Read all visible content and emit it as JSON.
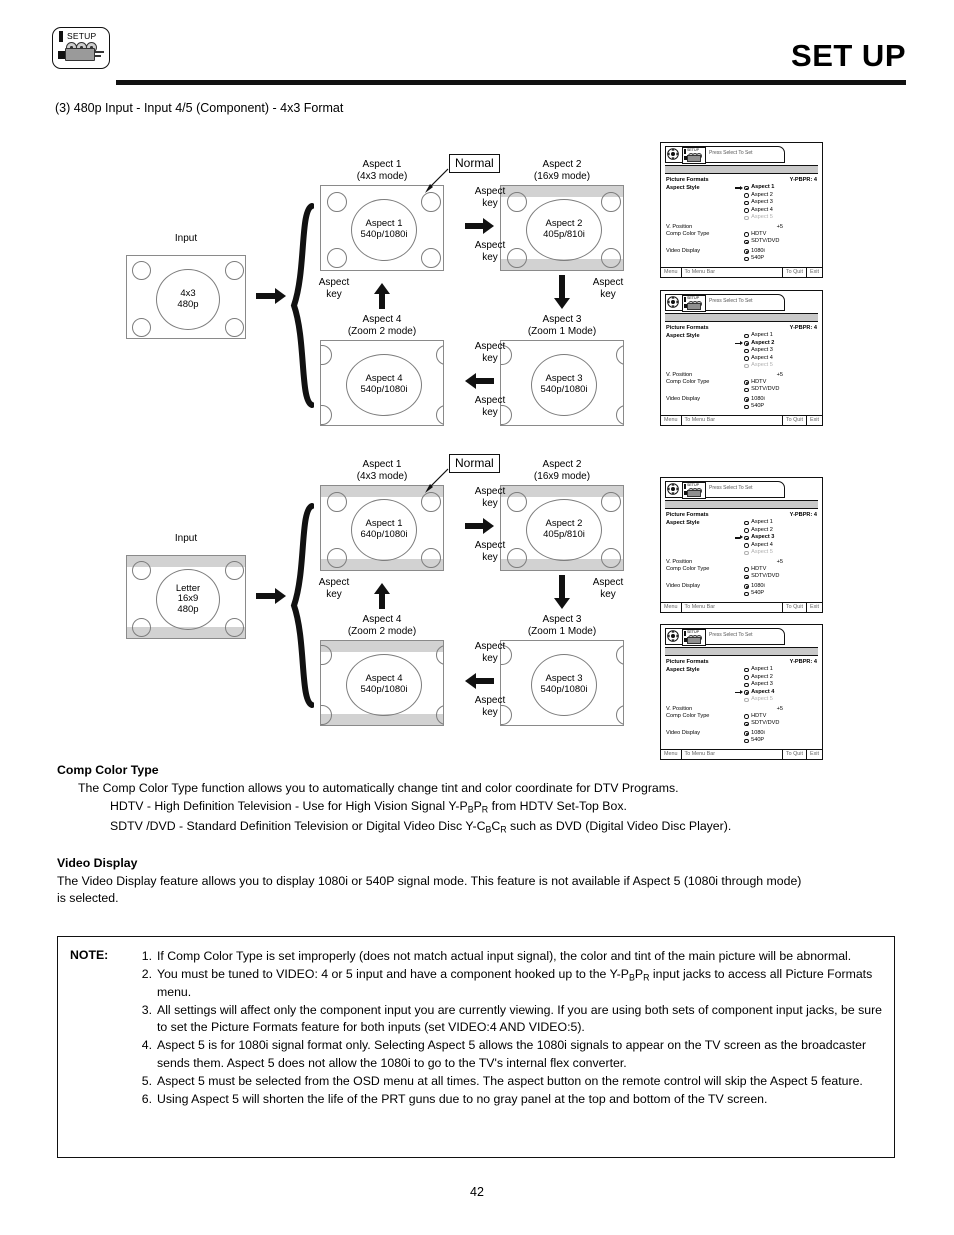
{
  "header": {
    "title": "SET UP",
    "badge_label": "SETUP"
  },
  "section_caption": "(3)  480p Input - Input 4/5 (Component) - 4x3 Format",
  "diagrams": [
    {
      "name": "480p-4x3-flow",
      "input": {
        "caption": "Input",
        "lines": [
          "4x3",
          "480p"
        ],
        "bands": false
      },
      "normal_tag": "Normal",
      "key_label": [
        "Aspect",
        "key"
      ],
      "boxes": [
        {
          "title": [
            "Aspect 1",
            "(4x3 mode)"
          ],
          "inner": [
            "Aspect 1",
            "540p/1080i"
          ],
          "bands": false,
          "corner": "full"
        },
        {
          "title": [
            "Aspect 2",
            "(16x9 mode)"
          ],
          "inner": [
            "Aspect 2",
            "405p/810i"
          ],
          "bands": true,
          "corner": "full"
        },
        {
          "title": [
            "Aspect 3",
            "(Zoom 1 Mode)"
          ],
          "inner": [
            "Aspect 3",
            "540p/1080i"
          ],
          "bands": false,
          "corner": "clip"
        },
        {
          "title": [
            "Aspect 4",
            "(Zoom 2 mode)"
          ],
          "inner": [
            "Aspect 4",
            "540p/1080i"
          ],
          "bands": false,
          "corner": "clip"
        }
      ]
    },
    {
      "name": "letterbox-16x9-flow",
      "input": {
        "caption": "Input",
        "lines": [
          "Letter",
          "16x9",
          "480p"
        ],
        "bands": true
      },
      "normal_tag": "Normal",
      "key_label": [
        "Aspect",
        "key"
      ],
      "boxes": [
        {
          "title": [
            "Aspect 1",
            "(4x3 mode)"
          ],
          "inner": [
            "Aspect 1",
            "640p/1080i"
          ],
          "bands": true,
          "corner": "full"
        },
        {
          "title": [
            "Aspect 2",
            "(16x9 mode)"
          ],
          "inner": [
            "Aspect 2",
            "405p/810i"
          ],
          "bands": true,
          "corner": "full"
        },
        {
          "title": [
            "Aspect 3",
            "(Zoom 1 Mode)"
          ],
          "inner": [
            "Aspect 3",
            "540p/1080i"
          ],
          "bands": false,
          "corner": "clip"
        },
        {
          "title": [
            "Aspect 4",
            "(Zoom 2 mode)"
          ],
          "inner": [
            "Aspect 4",
            "540p/1080i"
          ],
          "bands": true,
          "corner": "clip"
        }
      ]
    }
  ],
  "osd": {
    "press_text": "Press Select To Set",
    "title": "Picture Formats",
    "input_label": "Y-PBPR: 4",
    "aspect_style_label": "Aspect Style",
    "v_position_label": "V. Position",
    "v_position_value": "+5",
    "comp_color_label": "Comp Color Type",
    "video_display_label": "Video Display",
    "aspect_options": [
      "Aspect 1",
      "Aspect 2",
      "Aspect 3",
      "Aspect 4",
      "Aspect 5"
    ],
    "comp_color_options": [
      "HDTV",
      "SDTV/DVD"
    ],
    "video_display_options": [
      "1080i",
      "540P"
    ],
    "footer": [
      "Menu",
      "To Menu Bar",
      "To Quit",
      "Exit"
    ],
    "panels": [
      {
        "name": "osd-panel-aspect-1",
        "aspect_selected": 0,
        "comp_color_selected": 1,
        "video_display_selected": 0
      },
      {
        "name": "osd-panel-aspect-2",
        "aspect_selected": 1,
        "comp_color_selected": 0,
        "video_display_selected": 0
      },
      {
        "name": "osd-panel-aspect-3",
        "aspect_selected": 2,
        "comp_color_selected": 1,
        "video_display_selected": 0
      },
      {
        "name": "osd-panel-aspect-4",
        "aspect_selected": 3,
        "comp_color_selected": 1,
        "video_display_selected": 0
      }
    ]
  },
  "comp_color_type": {
    "heading": "Comp Color Type",
    "intro": "The Comp Color Type function allows you to automatically change tint and color coordinate for DTV Programs.",
    "hdtv_pre": "HDTV - High Definition Television - Use for High Vision Signal Y-P",
    "hdtv_sub1": "B",
    "hdtv_mid": "P",
    "hdtv_sub2": "R",
    "hdtv_post": " from HDTV Set-Top Box.",
    "sdtv_pre": "SDTV /DVD - Standard Definition Television or Digital Video Disc Y-C",
    "sdtv_sub1": "B",
    "sdtv_mid": "C",
    "sdtv_sub2": "R",
    "sdtv_post": " such as DVD (Digital Video Disc Player)."
  },
  "video_display": {
    "heading": "Video Display",
    "line1": "The Video Display feature allows you to display 1080i or 540P signal mode.  This feature is not available if Aspect 5 (1080i through mode)",
    "line2": "is selected."
  },
  "note": {
    "label": "NOTE:",
    "items": [
      {
        "num": "1.",
        "text": "If Comp Color Type is set improperly (does not match actual input signal), the color and tint of the main picture will be abnormal."
      },
      {
        "num": "2.",
        "text_pre": "You must be tuned to VIDEO: 4 or 5 input and have a component hooked up to the Y-P",
        "sub1": "B",
        "mid": "P",
        "sub2": "R",
        "text_post": " input jacks to access all Picture Formats menu."
      },
      {
        "num": "3.",
        "text": "All settings will affect only the component input you are currently viewing.  If you are using both sets of component input jacks, be sure to set the Picture Formats feature for both inputs (set VIDEO:4 AND VIDEO:5)."
      },
      {
        "num": "4.",
        "text": "Aspect 5 is for 1080i signal format only.  Selecting Aspect 5 allows the 1080i signals to appear on the TV screen as the broadcaster sends them.  Aspect 5 does not allow the 1080i to go to the TV's internal flex converter."
      },
      {
        "num": "5.",
        "text": "Aspect 5 must be selected from the OSD menu at all times.  The aspect button on the remote control will skip the Aspect 5 feature."
      },
      {
        "num": "6.",
        "text": "Using Aspect 5 will shorten the life of the PRT guns due to no gray panel at the top and bottom of the TV screen."
      }
    ]
  },
  "page_number": "42",
  "colors": {
    "gray_band": "#d2d2d2",
    "line": "#111111",
    "osd_strip": "#c9c9c9"
  }
}
